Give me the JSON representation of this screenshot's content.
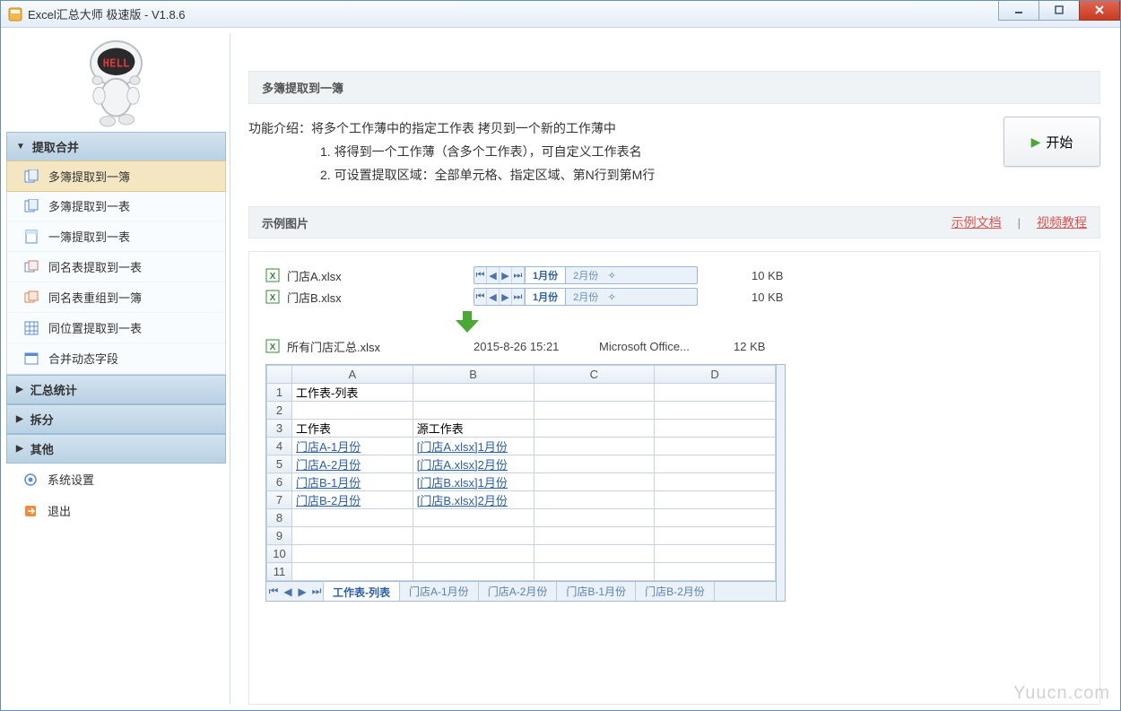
{
  "window": {
    "title": "Excel汇总大师 极速版 - V1.8.6"
  },
  "sidebar": {
    "groups": [
      {
        "label": "提取合并",
        "expanded": true,
        "items": [
          "多簿提取到一簿",
          "多簿提取到一表",
          "一簿提取到一表",
          "同名表提取到一表",
          "同名表重组到一簿",
          "同位置提取到一表",
          "合并动态字段"
        ],
        "selected": 0
      },
      {
        "label": "汇总统计",
        "expanded": false
      },
      {
        "label": "拆分",
        "expanded": false
      },
      {
        "label": "其他",
        "expanded": false
      }
    ],
    "settings": "系统设置",
    "exit": "退出"
  },
  "main": {
    "heading": "多簿提取到一簿",
    "intro_label": "功能介绍：",
    "intro_line": "将多个工作薄中的指定工作表 拷贝到一个新的工作薄中",
    "bullet1": "1. 将得到一个工作薄（含多个工作表），可自定义工作表名",
    "bullet2": "2. 可设置提取区域：全部单元格、指定区域、第N行到第M行",
    "start": "开始",
    "example_label": "示例图片",
    "link_doc": "示例文档",
    "link_video": "视频教程",
    "files": [
      {
        "name": "门店A.xlsx",
        "tabs": [
          "1月份",
          "2月份"
        ],
        "active": 0,
        "size": "10 KB"
      },
      {
        "name": "门店B.xlsx",
        "tabs": [
          "1月份",
          "2月份"
        ],
        "active": 0,
        "size": "10 KB"
      }
    ],
    "result": {
      "name": "所有门店汇总.xlsx",
      "date": "2015-8-26 15:21",
      "type": "Microsoft Office...",
      "size": "12 KB"
    },
    "sheet": {
      "cols": [
        "A",
        "B",
        "C",
        "D"
      ],
      "rows": [
        {
          "n": "1",
          "A": "工作表-列表",
          "B": ""
        },
        {
          "n": "2",
          "A": "",
          "B": ""
        },
        {
          "n": "3",
          "A": "工作表",
          "B": "源工作表"
        },
        {
          "n": "4",
          "A": "门店A-1月份",
          "B": "[门店A.xlsx]1月份",
          "link": true
        },
        {
          "n": "5",
          "A": "门店A-2月份",
          "B": "[门店A.xlsx]2月份",
          "link": true
        },
        {
          "n": "6",
          "A": "门店B-1月份",
          "B": "[门店B.xlsx]1月份",
          "link": true
        },
        {
          "n": "7",
          "A": "门店B-2月份",
          "B": "[门店B.xlsx]2月份",
          "link": true
        },
        {
          "n": "8",
          "A": "",
          "B": ""
        },
        {
          "n": "9",
          "A": "",
          "B": ""
        },
        {
          "n": "10",
          "A": "",
          "B": ""
        },
        {
          "n": "11",
          "A": "",
          "B": ""
        }
      ],
      "tabs": [
        "工作表-列表",
        "门店A-1月份",
        "门店A-2月份",
        "门店B-1月份",
        "门店B-2月份"
      ],
      "active_tab": 0
    }
  },
  "watermark": "Yuucn.com"
}
